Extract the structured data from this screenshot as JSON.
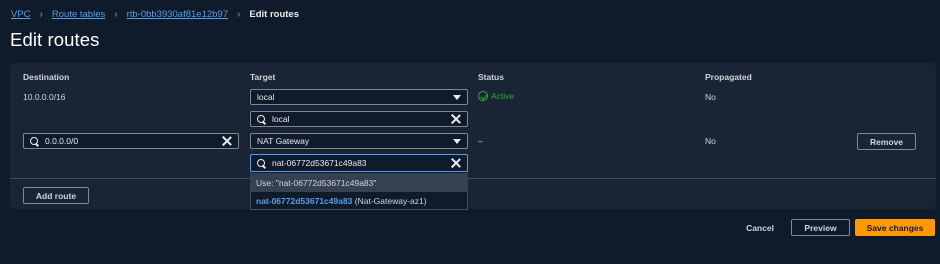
{
  "breadcrumb": {
    "items": [
      "VPC",
      "Route tables",
      "rtb-0bb3930af81e12b97"
    ],
    "current": "Edit routes"
  },
  "page_title": "Edit routes",
  "columns": {
    "destination": "Destination",
    "target": "Target",
    "status": "Status",
    "propagated": "Propagated"
  },
  "routes": [
    {
      "destination": "10.0.0.0/16",
      "target_value": "local",
      "target_filter": "local",
      "status": "Active",
      "propagated": "No"
    },
    {
      "destination": "0.0.0.0/0",
      "target_value": "NAT Gateway",
      "target_filter": "nat-06772d53671c49a83",
      "status": "–",
      "propagated": "No",
      "remove_label": "Remove"
    }
  ],
  "dropdown": {
    "use_option": "Use: \"nat-06772d53671c49a83\"",
    "match_id": "nat-06772d53671c49a83",
    "match_suffix": " (Nat-Gateway-az1)"
  },
  "add_route_label": "Add route",
  "footer": {
    "cancel": "Cancel",
    "preview": "Preview",
    "save": "Save changes"
  },
  "colors": {
    "background": "#0f1b2a",
    "panel": "#192534",
    "link": "#539fe5",
    "active_status": "#29ad32",
    "primary_button": "#ff9900"
  }
}
